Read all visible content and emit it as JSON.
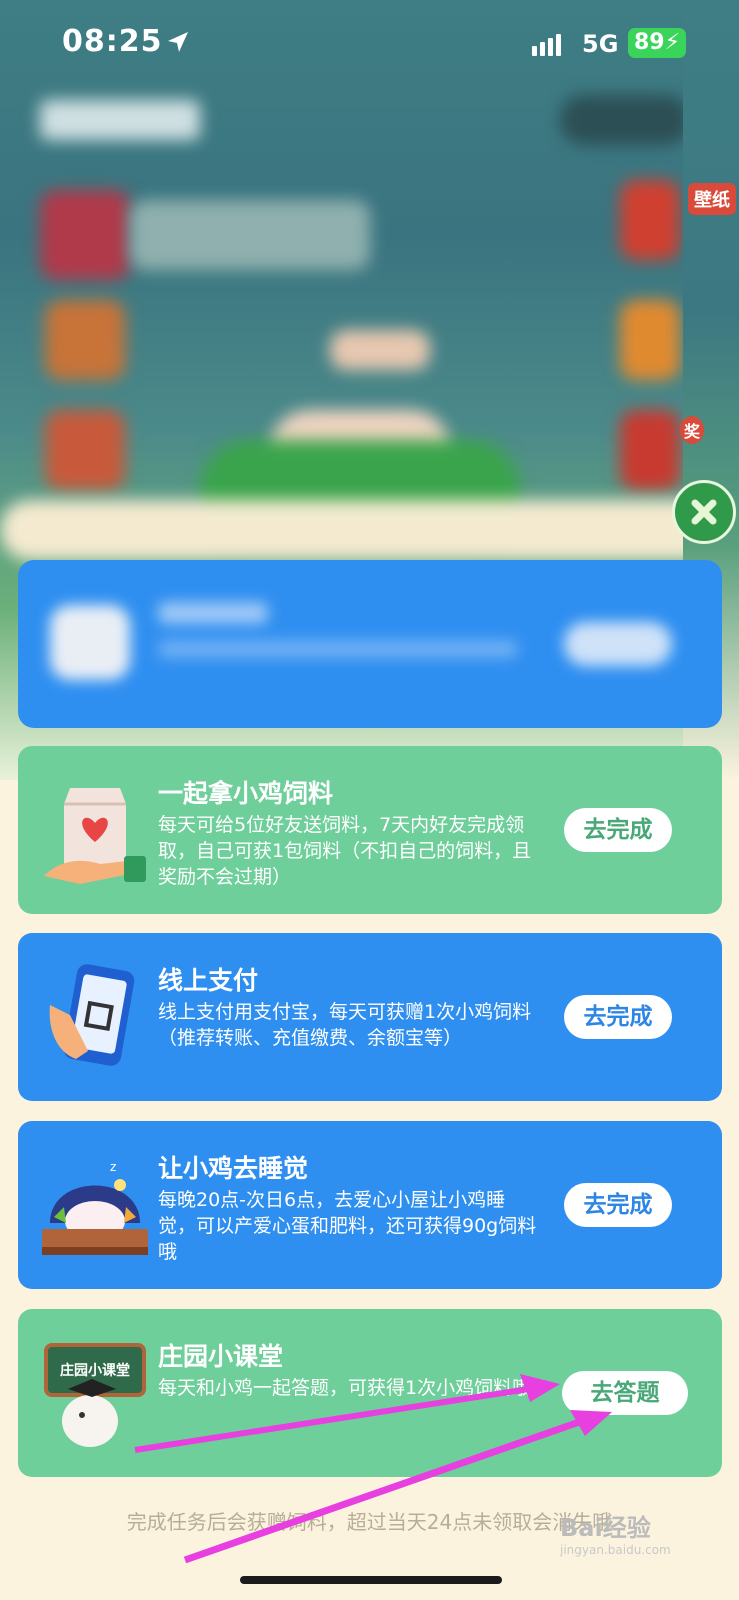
{
  "status_bar": {
    "time": "08:25",
    "network": "5G",
    "battery": "89"
  },
  "side_badges": {
    "wallpaper": "壁纸",
    "prize": "奖"
  },
  "tasks": [
    {
      "title": "一起拿小鸡饲料",
      "desc": "每天可给5位好友送饲料，7天内好友完成领取，自己可获1包饲料（不扣自己的饲料，且奖励不会过期）",
      "button": "去完成",
      "color": "green",
      "icon": "feed-bag-icon"
    },
    {
      "title": "线上支付",
      "desc": "线上支付用支付宝，每天可获赠1次小鸡饲料（推荐转账、充值缴费、余额宝等）",
      "button": "去完成",
      "color": "blue",
      "icon": "phone-payment-icon"
    },
    {
      "title": "让小鸡去睡觉",
      "desc": "每晚20点-次日6点，去爱心小屋让小鸡睡觉，可以产爱心蛋和肥料，还可获得90g饲料哦",
      "button": "去完成",
      "color": "blue",
      "icon": "sleeping-chick-icon"
    },
    {
      "title": "庄园小课堂",
      "desc": "每天和小鸡一起答题，可获得1次小鸡饲料哦",
      "button": "去答题",
      "color": "green",
      "icon": "classroom-chick-icon"
    }
  ],
  "classroom_sign": "庄园小课堂",
  "footer_note": "完成任务后会获赠饲料，超过当天24点未领取会消失哦",
  "watermark": {
    "brand": "Bai经验",
    "url": "jingyan.baidu.com"
  },
  "colors": {
    "green_card": "#6fcf9b",
    "blue_card": "#2f8ff0",
    "arrow": "#e83fe0"
  }
}
